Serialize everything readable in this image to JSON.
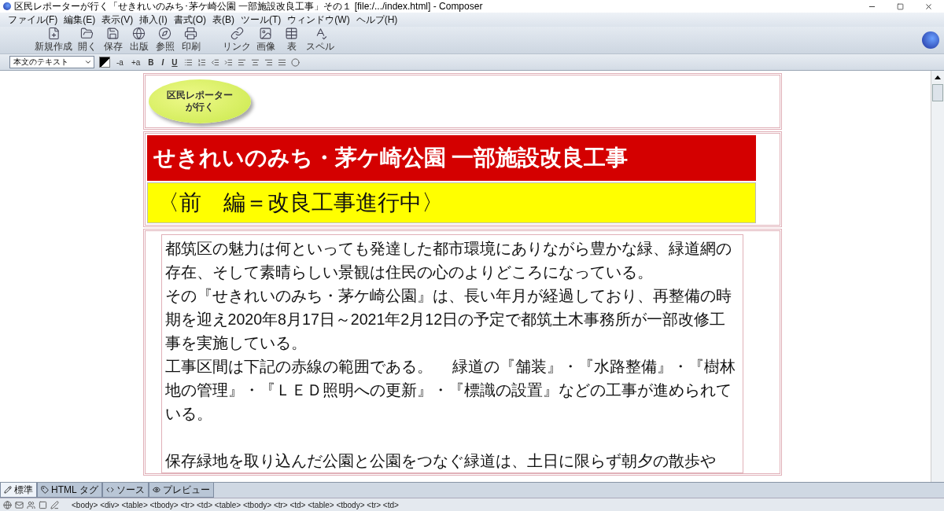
{
  "window": {
    "title": "区民レポーターが行く「せきれいのみち･茅ケ崎公園 一部施設改良工事」その１ [file:/.../index.html] - Composer"
  },
  "menu": [
    "ファイル(F)",
    "編集(E)",
    "表示(V)",
    "挿入(I)",
    "書式(O)",
    "表(B)",
    "ツール(T)",
    "ウィンドウ(W)",
    "ヘルプ(H)"
  ],
  "toolbar": [
    {
      "kind": "new",
      "label": "新規作成"
    },
    {
      "kind": "open",
      "label": "開く"
    },
    {
      "kind": "save",
      "label": "保存"
    },
    {
      "kind": "publish",
      "label": "出版"
    },
    {
      "kind": "browse",
      "label": "参照"
    },
    {
      "kind": "print",
      "label": "印刷"
    },
    {
      "kind": "link",
      "label": "リンク"
    },
    {
      "kind": "image",
      "label": "画像"
    },
    {
      "kind": "table",
      "label": "表"
    },
    {
      "kind": "spell",
      "label": "スペル"
    }
  ],
  "format_bar": {
    "paragraph_style": "本文のテキスト",
    "text_buttons": [
      "-a",
      "+a",
      "B",
      "I",
      "U"
    ]
  },
  "document": {
    "badge": [
      "区民レポーター",
      "が行く"
    ],
    "title": "せきれいのみち・茅ケ崎公園 一部施設改良工事",
    "subtitle": "〈前　編＝改良工事進行中〉",
    "paragraphs": [
      "都筑区の魅力は何といっても発達した都市環境にありながら豊かな緑、緑道網の存在、そして素晴らしい景観は住民の心のよりどころになっている。",
      "その『せきれいのみち・茅ケ崎公園』は、長い年月が経過しており、再整備の時期を迎え2020年8月17日～2021年2月12日の予定で都筑土木事務所が一部改修工事を実施している。",
      "工事区間は下記の赤線の範囲である。　 緑道の『舗装』・『水路整備』・『樹林地の管理』・『ＬＥＤ照明への更新』・『標識の設置』などの工事が進められている。"
    ],
    "next_paragraph": "保存緑地を取り込んだ公園と公園をつなぐ緑道は、土日に限らず朝夕の散歩や"
  },
  "view_tabs": [
    {
      "kind": "normal",
      "label": "標準",
      "selected": true
    },
    {
      "kind": "tags",
      "label": "HTML タグ",
      "selected": false
    },
    {
      "kind": "source",
      "label": "ソース",
      "selected": false
    },
    {
      "kind": "preview",
      "label": "プレビュー",
      "selected": false
    }
  ],
  "status_bar": {
    "tag_path": "<body> <div> <table> <tbody> <tr> <td> <table> <tbody> <tr> <td> <table> <tbody> <tr> <td>"
  }
}
